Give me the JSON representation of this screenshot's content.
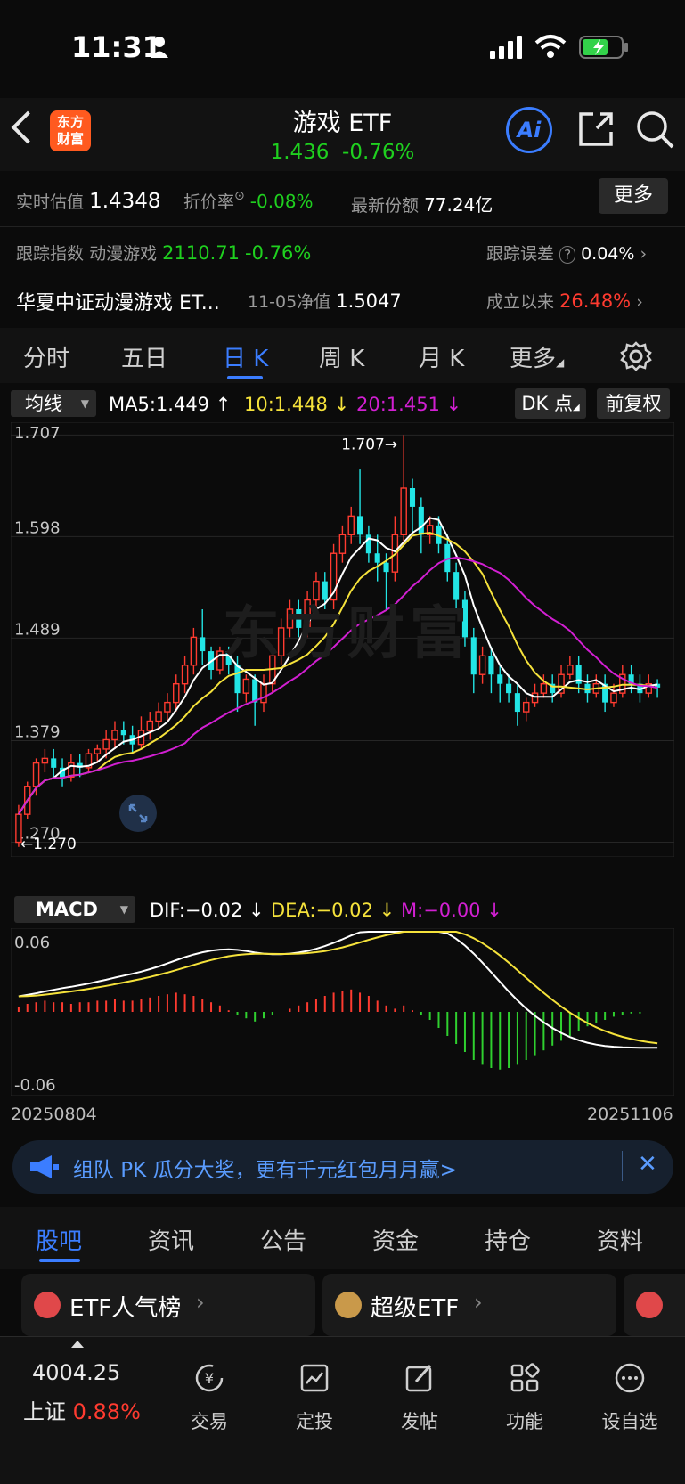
{
  "status_bar": {
    "time": "11:31"
  },
  "header": {
    "logo_line1": "东方",
    "logo_line2": "财富",
    "title": "游戏 ETF",
    "price": "1.436",
    "change": "-0.76%",
    "ai_label": "Ai"
  },
  "info": {
    "realtime_label": "实时估值",
    "realtime_value": "1.4348",
    "premium_label": "折价率",
    "premium_value": "-0.08%",
    "shares_label": "最新份额",
    "shares_value": "77.24亿",
    "more_button": "更多",
    "track_label": "跟踪指数",
    "track_name": "动漫游戏",
    "track_value": "2110.71",
    "track_change": "-0.76%",
    "error_label": "跟踪误差",
    "error_value": "0.04%",
    "fund_name": "华夏中证动漫游戏 ET...",
    "nav_date": "11-05",
    "nav_label": "净值",
    "nav_value": "1.5047",
    "since_label": "成立以来",
    "since_value": "26.48%"
  },
  "tabs": [
    "分时",
    "五日",
    "日 K",
    "周 K",
    "月 K",
    "更多"
  ],
  "chart_toolbar": {
    "ma_select": "均线",
    "ma5": "MA5:1.449",
    "ma10": "10:1.448",
    "ma20": "20:1.451",
    "dk_button": "DK 点",
    "adjust_button": "前复权"
  },
  "macd_toolbar": {
    "select": "MACD",
    "dif": "DIF:−0.02",
    "dea": "DEA:−0.02",
    "m": "M:−0.00"
  },
  "colors": {
    "up": "#ff3b30",
    "down": "#22e5e5",
    "ma5": "#ffffff",
    "ma10": "#f5e23b",
    "ma20": "#d21fd2",
    "accent": "#3b7dff"
  },
  "chart_data": [
    {
      "type": "candlestick",
      "title": "",
      "y_ticks": [
        "1.707",
        "1.598",
        "1.489",
        "1.379",
        "1.270"
      ],
      "ylim": [
        1.26,
        1.715
      ],
      "annotations": [
        "1.707→",
        "←1.270"
      ],
      "candles": [
        [
          1.27,
          1.3,
          1.265,
          1.31
        ],
        [
          1.3,
          1.33,
          1.295,
          1.335
        ],
        [
          1.33,
          1.355,
          1.32,
          1.36
        ],
        [
          1.355,
          1.36,
          1.345,
          1.37
        ],
        [
          1.36,
          1.35,
          1.34,
          1.37
        ],
        [
          1.35,
          1.34,
          1.33,
          1.36
        ],
        [
          1.34,
          1.355,
          1.335,
          1.365
        ],
        [
          1.355,
          1.35,
          1.34,
          1.365
        ],
        [
          1.35,
          1.365,
          1.345,
          1.37
        ],
        [
          1.365,
          1.37,
          1.355,
          1.375
        ],
        [
          1.37,
          1.38,
          1.36,
          1.39
        ],
        [
          1.38,
          1.39,
          1.37,
          1.4
        ],
        [
          1.39,
          1.385,
          1.375,
          1.4
        ],
        [
          1.385,
          1.375,
          1.365,
          1.395
        ],
        [
          1.375,
          1.39,
          1.37,
          1.405
        ],
        [
          1.39,
          1.4,
          1.38,
          1.41
        ],
        [
          1.4,
          1.41,
          1.39,
          1.42
        ],
        [
          1.41,
          1.42,
          1.4,
          1.43
        ],
        [
          1.42,
          1.44,
          1.41,
          1.45
        ],
        [
          1.44,
          1.46,
          1.43,
          1.47
        ],
        [
          1.46,
          1.49,
          1.45,
          1.5
        ],
        [
          1.49,
          1.475,
          1.46,
          1.52
        ],
        [
          1.475,
          1.455,
          1.445,
          1.48
        ],
        [
          1.455,
          1.475,
          1.45,
          1.48
        ],
        [
          1.475,
          1.46,
          1.45,
          1.48
        ],
        [
          1.46,
          1.43,
          1.41,
          1.47
        ],
        [
          1.43,
          1.445,
          1.42,
          1.45
        ],
        [
          1.445,
          1.42,
          1.395,
          1.45
        ],
        [
          1.42,
          1.44,
          1.41,
          1.45
        ],
        [
          1.44,
          1.47,
          1.43,
          1.48
        ],
        [
          1.47,
          1.5,
          1.46,
          1.51
        ],
        [
          1.5,
          1.52,
          1.49,
          1.53
        ],
        [
          1.52,
          1.5,
          1.49,
          1.53
        ],
        [
          1.5,
          1.53,
          1.49,
          1.54
        ],
        [
          1.53,
          1.55,
          1.52,
          1.56
        ],
        [
          1.55,
          1.53,
          1.52,
          1.56
        ],
        [
          1.53,
          1.58,
          1.52,
          1.59
        ],
        [
          1.58,
          1.6,
          1.57,
          1.61
        ],
        [
          1.6,
          1.62,
          1.59,
          1.63
        ],
        [
          1.62,
          1.6,
          1.59,
          1.67
        ],
        [
          1.6,
          1.58,
          1.57,
          1.61
        ],
        [
          1.58,
          1.57,
          1.55,
          1.6
        ],
        [
          1.57,
          1.56,
          1.52,
          1.58
        ],
        [
          1.56,
          1.6,
          1.55,
          1.62
        ],
        [
          1.6,
          1.65,
          1.59,
          1.707
        ],
        [
          1.65,
          1.63,
          1.6,
          1.66
        ],
        [
          1.63,
          1.6,
          1.58,
          1.64
        ],
        [
          1.6,
          1.61,
          1.59,
          1.62
        ],
        [
          1.61,
          1.59,
          1.58,
          1.62
        ],
        [
          1.59,
          1.56,
          1.55,
          1.6
        ],
        [
          1.56,
          1.53,
          1.52,
          1.57
        ],
        [
          1.53,
          1.49,
          1.48,
          1.54
        ],
        [
          1.49,
          1.45,
          1.43,
          1.5
        ],
        [
          1.45,
          1.47,
          1.44,
          1.48
        ],
        [
          1.47,
          1.45,
          1.43,
          1.48
        ],
        [
          1.45,
          1.44,
          1.42,
          1.46
        ],
        [
          1.44,
          1.43,
          1.42,
          1.45
        ],
        [
          1.43,
          1.41,
          1.395,
          1.44
        ],
        [
          1.41,
          1.42,
          1.4,
          1.425
        ],
        [
          1.42,
          1.43,
          1.415,
          1.44
        ],
        [
          1.43,
          1.44,
          1.425,
          1.45
        ],
        [
          1.44,
          1.43,
          1.42,
          1.45
        ],
        [
          1.43,
          1.45,
          1.425,
          1.46
        ],
        [
          1.45,
          1.46,
          1.445,
          1.47
        ],
        [
          1.46,
          1.44,
          1.43,
          1.47
        ],
        [
          1.44,
          1.43,
          1.42,
          1.45
        ],
        [
          1.43,
          1.44,
          1.425,
          1.45
        ],
        [
          1.44,
          1.42,
          1.41,
          1.45
        ],
        [
          1.42,
          1.43,
          1.415,
          1.44
        ],
        [
          1.43,
          1.45,
          1.425,
          1.46
        ],
        [
          1.45,
          1.44,
          1.43,
          1.46
        ],
        [
          1.44,
          1.43,
          1.42,
          1.45
        ],
        [
          1.43,
          1.44,
          1.425,
          1.45
        ],
        [
          1.44,
          1.436,
          1.425,
          1.445
        ]
      ]
    },
    {
      "type": "macd",
      "y_ticks": [
        "0.06",
        "-0.06"
      ],
      "ylim": [
        -0.065,
        0.065
      ],
      "x_labels": [
        "20250804",
        "20251106"
      ],
      "hist": [
        0.003,
        0.005,
        0.006,
        0.007,
        0.006,
        0.006,
        0.005,
        0.006,
        0.006,
        0.007,
        0.007,
        0.008,
        0.007,
        0.007,
        0.008,
        0.009,
        0.01,
        0.011,
        0.012,
        0.011,
        0.01,
        0.008,
        0.006,
        0.004,
        0.001,
        -0.002,
        -0.004,
        -0.006,
        -0.004,
        -0.002,
        0.0,
        0.002,
        0.004,
        0.006,
        0.008,
        0.01,
        0.012,
        0.013,
        0.014,
        0.012,
        0.01,
        0.007,
        0.004,
        0.002,
        0.004,
        0.001,
        -0.002,
        -0.005,
        -0.01,
        -0.015,
        -0.02,
        -0.025,
        -0.03,
        -0.033,
        -0.035,
        -0.036,
        -0.035,
        -0.033,
        -0.03,
        -0.027,
        -0.024,
        -0.021,
        -0.018,
        -0.015,
        -0.012,
        -0.009,
        -0.007,
        -0.005,
        -0.003,
        -0.002,
        -0.001,
        -0.001,
        0.0,
        0.0
      ]
    }
  ],
  "banner": {
    "text": "组队 PK 瓜分大奖，更有千元红包月月赢>"
  },
  "lower_tabs": [
    "股吧",
    "资讯",
    "公告",
    "资金",
    "持仓",
    "资料"
  ],
  "cards": [
    {
      "title": "ETF人气榜"
    },
    {
      "title": "超级ETF"
    }
  ],
  "bottom_bar": {
    "index_value": "4004.25",
    "index_name": "上证",
    "index_change": "0.88%",
    "items": [
      "交易",
      "定投",
      "发帖",
      "功能",
      "设自选"
    ]
  }
}
